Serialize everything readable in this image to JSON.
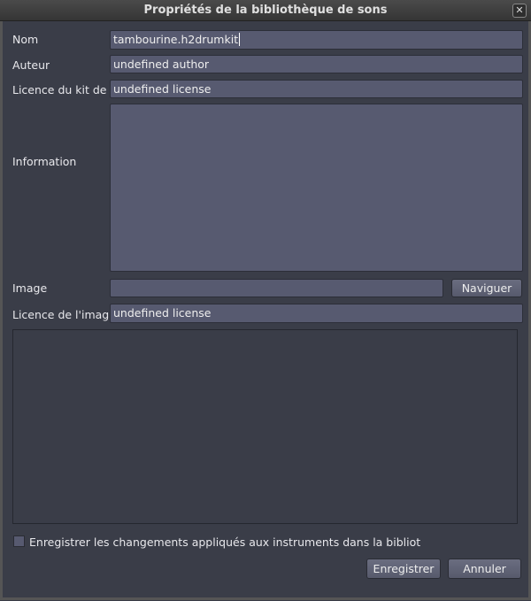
{
  "window": {
    "title": "Propriétés de la bibliothèque de sons",
    "close": "✕"
  },
  "form": {
    "name_label": "Nom",
    "name_value": "tambourine.h2drumkit",
    "author_label": "Auteur",
    "author_value": "undefined author",
    "license_label": "Licence du kit de",
    "license_value": "undefined license",
    "info_label": "Information",
    "info_value": "",
    "image_label": "Image",
    "image_value": "",
    "browse": "Naviguer",
    "image_license_label": "Licence de l'imag",
    "image_license_value": "undefined license",
    "apply_checkbox": "Enregistrer les changements appliqués aux instruments dans la bibliot"
  },
  "buttons": {
    "save": "Enregistrer",
    "cancel": "Annuler"
  }
}
